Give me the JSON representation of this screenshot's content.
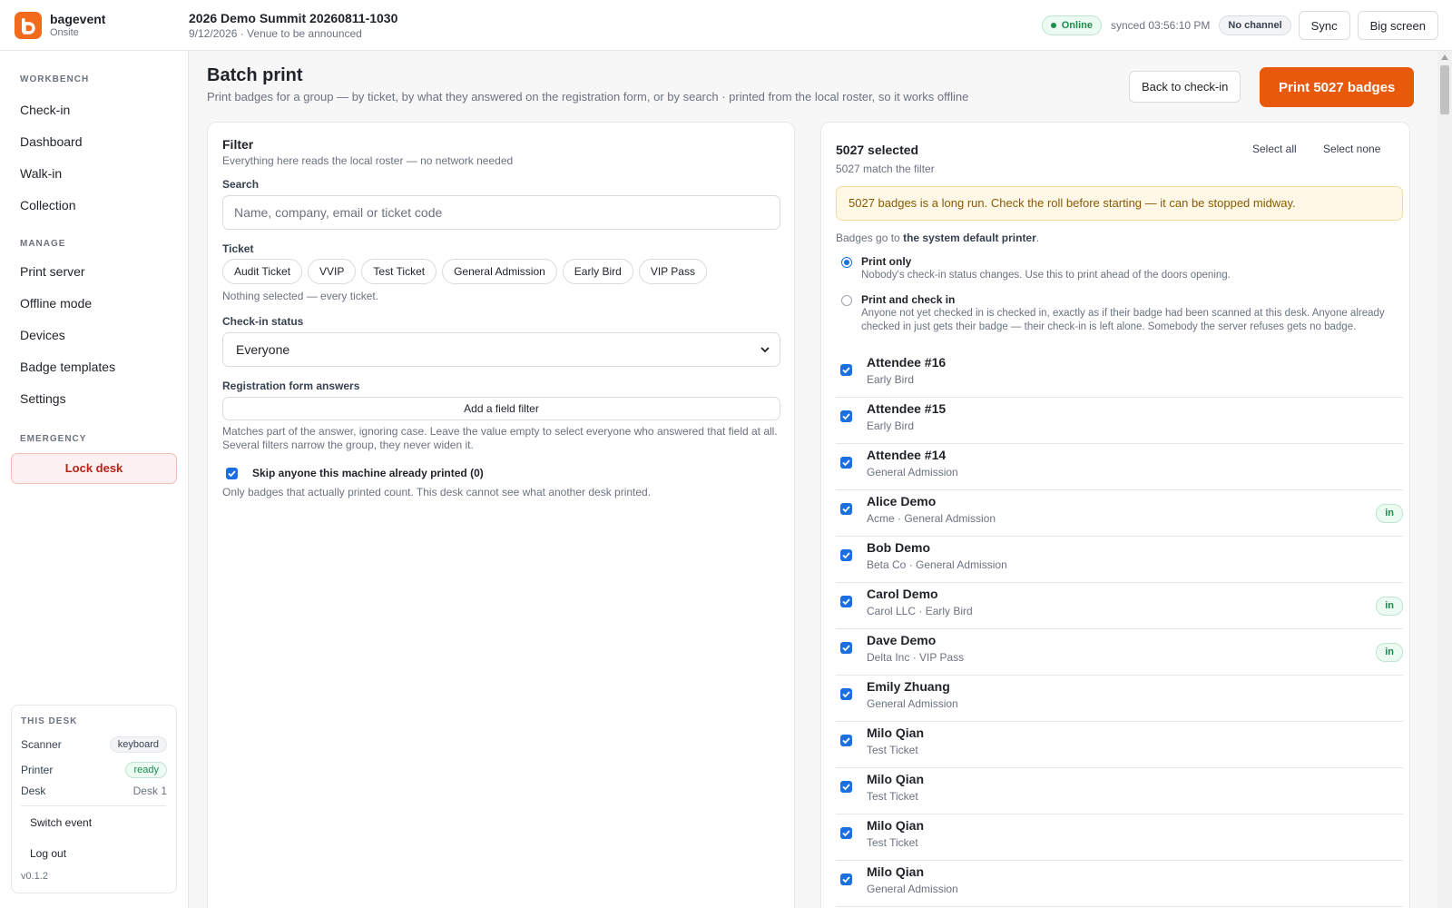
{
  "brand": {
    "name": "bagevent",
    "sub": "Onsite",
    "logo_letter": "b"
  },
  "event": {
    "title": "2026 Demo Summit 20260811-1030",
    "subtitle": "9/12/2026 · Venue to be announced"
  },
  "status": {
    "online": "Online",
    "synced": "synced 03:56:10 PM",
    "channel": "No channel",
    "sync_btn": "Sync",
    "bigscreen_btn": "Big screen"
  },
  "sidebar": {
    "workbench_head": "WORKBENCH",
    "workbench": [
      "Check-in",
      "Dashboard",
      "Walk-in",
      "Collection"
    ],
    "manage_head": "MANAGE",
    "manage": [
      "Print server",
      "Offline mode",
      "Devices",
      "Badge templates",
      "Settings"
    ],
    "emergency_head": "EMERGENCY",
    "lock": "Lock desk",
    "desk": {
      "head": "THIS DESK",
      "scanner_label": "Scanner",
      "scanner_value": "keyboard",
      "printer_label": "Printer",
      "printer_value": "ready",
      "desk_label": "Desk",
      "desk_value": "Desk 1",
      "switch_event": "Switch event",
      "logout": "Log out",
      "version": "v0.1.2"
    }
  },
  "page": {
    "title": "Batch print",
    "subtitle": "Print badges for a group — by ticket, by what they answered on the registration form, or by search · printed from the local roster, so it works offline",
    "back_btn": "Back to check-in",
    "print_btn": "Print 5027 badges"
  },
  "filter": {
    "title": "Filter",
    "subtitle": "Everything here reads the local roster — no network needed",
    "search_label": "Search",
    "search_placeholder": "Name, company, email or ticket code",
    "ticket_label": "Ticket",
    "tickets": [
      "Audit Ticket",
      "VVIP",
      "Test Ticket",
      "General Admission",
      "Early Bird",
      "VIP Pass"
    ],
    "ticket_hint": "Nothing selected — every ticket.",
    "status_label": "Check-in status",
    "status_value": "Everyone",
    "form_label": "Registration form answers",
    "add_field": "Add a field filter",
    "form_hint": "Matches part of the answer, ignoring case. Leave the value empty to select everyone who answered that field at all. Several filters narrow the group, they never widen it.",
    "skip_label": "Skip anyone this machine already printed (0)",
    "skip_checked": true,
    "skip_hint": "Only badges that actually printed count. This desk cannot see what another desk printed."
  },
  "selection": {
    "title": "5027 selected",
    "subtitle": "5027 match the filter",
    "select_all": "Select all",
    "select_none": "Select none",
    "warning": "5027 badges is a long run. Check the roll before starting — it can be stopped midway.",
    "printer_prefix": "Badges go to",
    "printer_name": "the system default printer",
    "printer_suffix": ".",
    "mode_print_only_title": "Print only",
    "mode_print_only_desc": "Nobody's check-in status changes. Use this to print ahead of the doors opening.",
    "mode_checkin_title": "Print and check in",
    "mode_checkin_desc": "Anyone not yet checked in is checked in, exactly as if their badge had been scanned at this desk. Anyone already checked in just gets their badge — their check-in is left alone. Somebody the server refuses gets no badge.",
    "selected_mode": "Print only",
    "attendees": [
      {
        "name": "Attendee #16",
        "sub": "Early Bird",
        "in": ""
      },
      {
        "name": "Attendee #15",
        "sub": "Early Bird",
        "in": ""
      },
      {
        "name": "Attendee #14",
        "sub": "General Admission",
        "in": ""
      },
      {
        "name": "Alice Demo",
        "sub": "Acme · General Admission",
        "in": "in"
      },
      {
        "name": "Bob Demo",
        "sub": "Beta Co · General Admission",
        "in": ""
      },
      {
        "name": "Carol Demo",
        "sub": "Carol LLC · Early Bird",
        "in": "in"
      },
      {
        "name": "Dave Demo",
        "sub": "Delta Inc · VIP Pass",
        "in": "in"
      },
      {
        "name": "Emily Zhuang",
        "sub": "General Admission",
        "in": ""
      },
      {
        "name": "Milo Qian",
        "sub": "Test Ticket",
        "in": ""
      },
      {
        "name": "Milo Qian",
        "sub": "Test Ticket",
        "in": ""
      },
      {
        "name": "Milo Qian",
        "sub": "Test Ticket",
        "in": ""
      },
      {
        "name": "Milo Qian",
        "sub": "General Admission",
        "in": ""
      }
    ]
  },
  "colors": {
    "accent": "#e8590c",
    "brand": "#f26b1d",
    "success": "#1d8a4e",
    "danger": "#b42318",
    "checkbox": "#1b6fe0"
  }
}
